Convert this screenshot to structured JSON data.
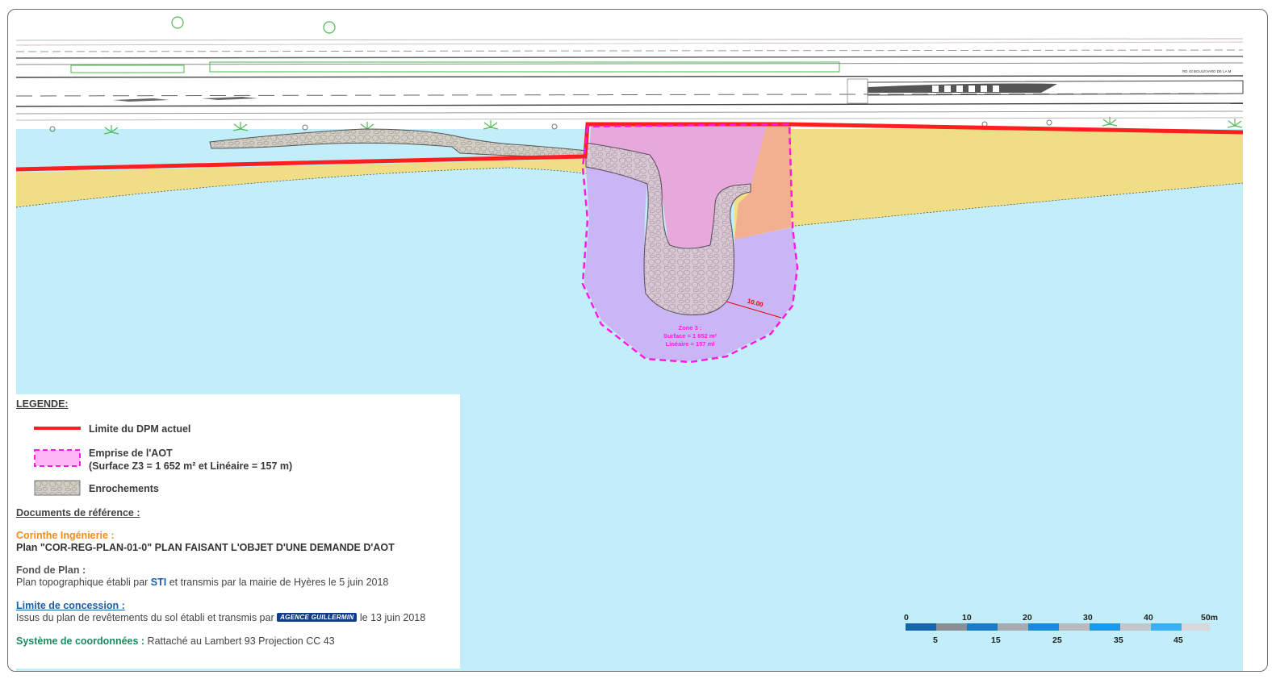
{
  "map": {
    "zone_label_line1": "Zone 3 :",
    "zone_label_line2": "Surface = 1 652 m²",
    "zone_label_line3": "Linéaire = 157 ml",
    "dimension_label": "10.00",
    "road_label": "RD 42    BOULEVARD DE LA M",
    "colors": {
      "sea": "#c2eefa",
      "beach": "#efde86",
      "dpm_line": "#ff1e1e",
      "aot_zone_fill": "#c9b5f4",
      "aot_boundary": "#ff19e6",
      "upper_zone": "#e8a8dd",
      "orange_zone": "#f3b091",
      "rocks": "#d9c9d4"
    }
  },
  "legend": {
    "title": "LEGENDE:",
    "items": [
      {
        "label": "Limite du DPM actuel"
      },
      {
        "label": "Emprise de l'AOT",
        "sublabel": "(Surface Z3 = 1 652 m² et Linéaire = 157 m)"
      },
      {
        "label": "Enrochements"
      }
    ],
    "ref_title": "Documents de référence :",
    "corinthe_title": "Corinthe Ingénierie :",
    "corinthe_plan_prefix": "Plan ",
    "corinthe_plan_code": "\"COR-REG-PLAN-01-0\"",
    "corinthe_plan_desc": " PLAN FAISANT L'OBJET D'UNE DEMANDE D'AOT",
    "fond_title": "Fond de Plan :",
    "fond_text1": "Plan topographique établi par ",
    "fond_sti": "STI",
    "fond_text2": " et transmis par la mairie de Hyères le 5 juin 2018",
    "limite_title": "Limite de concession :",
    "limite_text1": "Issus du plan de revêtements du sol établi et transmis par ",
    "limite_logo": "AGENCE GUILLERMIN",
    "limite_text2": " le 13 juin 2018",
    "systeme_title": "Système de coordonnées :",
    "systeme_text": " Rattaché au Lambert 93 Projection CC 43"
  },
  "scale_bar": {
    "top_labels": [
      "0",
      "10",
      "20",
      "30",
      "40",
      "50m"
    ],
    "bottom_labels": [
      "5",
      "15",
      "25",
      "35",
      "45"
    ]
  }
}
